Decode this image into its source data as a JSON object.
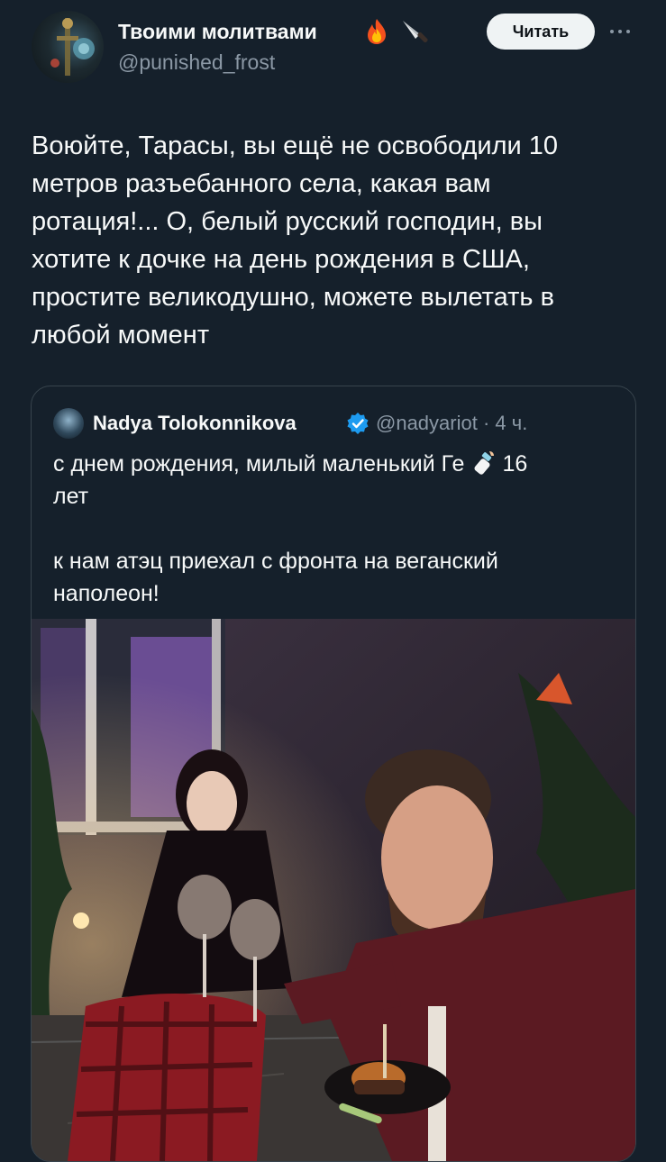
{
  "author": {
    "display_name": "Твоими молитвами",
    "handle": "@punished_frost",
    "badges": [
      "fire-emoji",
      "knife-emoji"
    ]
  },
  "actions": {
    "follow_label": "Читать",
    "more_icon": "more-icon"
  },
  "tweet": {
    "lines": [
      "Воюйте, Тарасы, вы ещё не освободили 10",
      "метров разъебанного села, какая вам",
      "ротация!... О, белый  русский господин, вы",
      "хотите к дочке на день рождения в США,",
      "простите великодушно, можете вылетать в",
      "любой момент"
    ]
  },
  "quote": {
    "display_name": "Nadya Tolokonnikova",
    "handle_time": "@nadyariot · 4 ч.",
    "verified": true,
    "text": {
      "line1_a": "с днем рождения, милый маленький Ге",
      "line1_b": "16",
      "line2": "лет",
      "line3": "к нам атэц приехал с фронта на веганский",
      "line4": "наполеон!"
    },
    "emoji": "baby-bottle-emoji",
    "photo": "photo of a woman and a man toasting with wine glasses at night in a garden, man holding a burger"
  },
  "colors": {
    "background": "#15202b",
    "text": "#f7f9f9",
    "secondary_text": "#8b98a5",
    "border": "#38444d",
    "verified": "#1d9bf0",
    "button_bg": "#eff3f4"
  }
}
